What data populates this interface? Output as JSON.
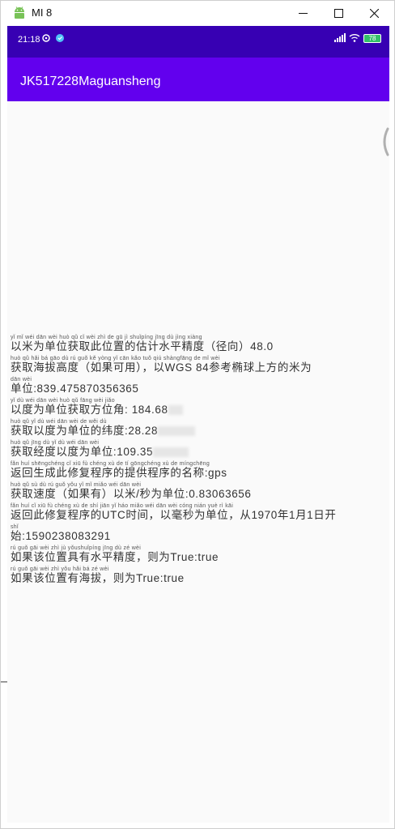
{
  "window": {
    "title": "MI 8"
  },
  "statusbar": {
    "time": "21:18",
    "battery": "78"
  },
  "appbar": {
    "title": "JK517228Maguansheng"
  },
  "content": {
    "lines": [
      {
        "pinyin": "yǐ  mǐ  wéi dān wèi huò  qǔ   cǐ  wèi  zhì  de  gū   jì  shuǐpíng jīng  dù         jìng xiàng",
        "text": "以米为单位获取此位置的估计水平精度（径向）48.0"
      },
      {
        "pinyin": "huò  qǔ  hǎi  bá  gāo  dù        rú  guǒ  kě  yòng                yǐ                    cān kǎo tuǒ  qiú shàngfāng de   mǐ  wèi",
        "text": "获取海拔高度（如果可用），以WGS 84参考椭球上方的米为"
      },
      {
        "pinyin": "dān wèi",
        "text": "单位:839.475870356365"
      },
      {
        "pinyin": "yǐ   dù  wéi dān wèi huò  qǔ fāng wèi jiǎo",
        "text": "以度为单位获取方位角: 184.68"
      },
      {
        "pinyin": "huò  qǔ   yǐ   dù  wéi dān wèi  de  wěi  dù",
        "text": "获取以度为单位的纬度:28.28"
      },
      {
        "pinyin": "huò  qǔ jīng  dù   yǐ   dù  wéi dān wèi",
        "text": "获取经度以度为单位:109.35"
      },
      {
        "pinyin": "fǎn huí shēngchéng cǐ   xiū   fù chéng xù   de    tí gōngchéng xù  de míngchēng",
        "text": "返回生成此修复程序的提供程序的名称:gps"
      },
      {
        "pinyin": "huò  qǔ  sù  dù        rú  guǒ yǒu         yǐ   mǐ   miǎo wéi dān wèi",
        "text": "获取速度（如果有）以米/秒为单位:0.83063656"
      },
      {
        "pinyin": "fǎn  huí   cǐ   xiū   fù chéng xù   de                shí  jiān         yǐ  háo miǎo wéi dān wèi        cóng              nián  yuè    rì  kāi",
        "text": "返回此修复程序的UTC时间，以毫秒为单位，从1970年1月1日开"
      },
      {
        "pinyin": "shǐ",
        "text": "始:1590238083291"
      },
      {
        "pinyin": " rú  guǒ gāi wèi zhì   jù   yǒushuǐpíng jīng  dù         zé   wèi",
        "text": "如果该位置具有水平精度，则为True:true"
      },
      {
        "pinyin": " rú  guǒ gāi wèi zhì yǒu  hǎi  bá        zé   wèi",
        "text": "如果该位置有海拔，则为True:true"
      }
    ]
  },
  "colors": {
    "statusbar": "#3700b3",
    "appbar": "#6200ee",
    "background": "#fafafa"
  },
  "icons": {
    "window": "android-icon",
    "minimize": "minimize-icon",
    "maximize": "maximize-icon",
    "close": "close-icon",
    "notification_1": "sync-icon",
    "notification_2": "app-notification-icon",
    "signal": "signal-icon",
    "wifi": "wifi-icon",
    "battery": "battery-icon"
  }
}
